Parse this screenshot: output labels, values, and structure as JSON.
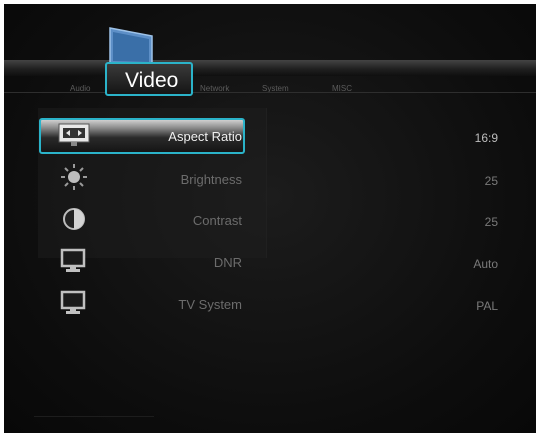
{
  "tabs": {
    "audio": "Audio",
    "video": "Video",
    "network": "Network",
    "system": "System",
    "misc": "MISC"
  },
  "accent_color": "#2bb3c9",
  "settings": [
    {
      "label": "Aspect Ratio",
      "value": "16:9",
      "icon": "aspect-ratio-icon",
      "selected": true
    },
    {
      "label": "Brightness",
      "value": "25",
      "icon": "sun-icon"
    },
    {
      "label": "Contrast",
      "value": "25",
      "icon": "contrast-icon"
    },
    {
      "label": "DNR",
      "value": "Auto",
      "icon": "monitor-icon"
    },
    {
      "label": "TV System",
      "value": "PAL",
      "icon": "monitor-icon"
    }
  ]
}
